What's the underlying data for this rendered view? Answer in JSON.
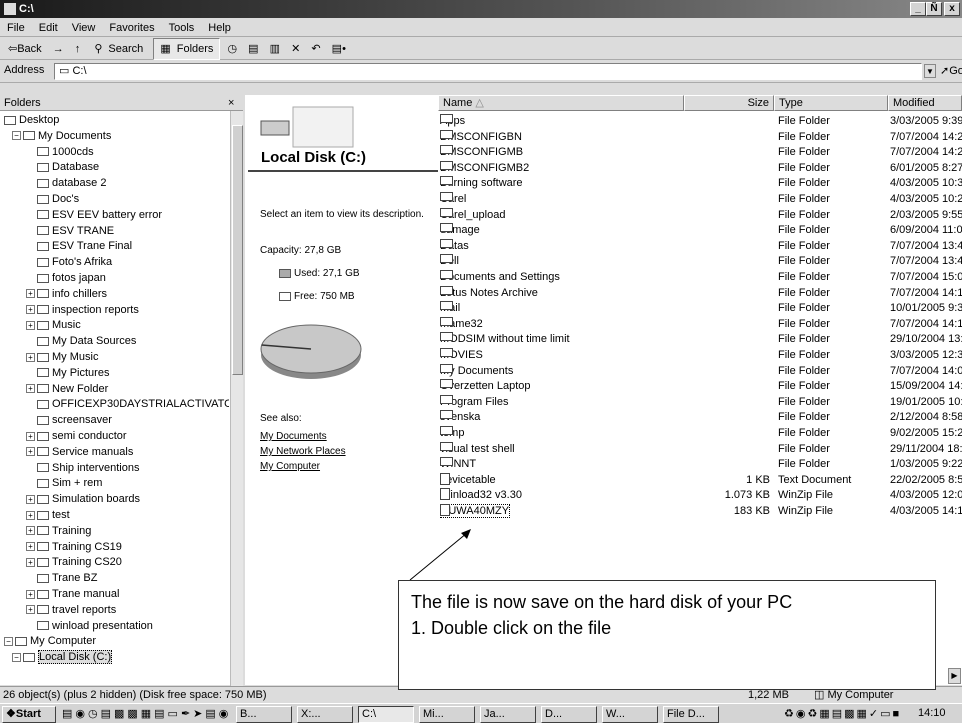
{
  "window": {
    "title": "C:\\",
    "minimize": "_",
    "restore": "Ñ",
    "close": "x"
  },
  "menu": [
    "File",
    "Edit",
    "View",
    "Favorites",
    "Tools",
    "Help"
  ],
  "toolbar": {
    "back": "⇦Back",
    "forward": "→",
    "up": "·",
    "search": "Search",
    "folders": "Folders",
    "views": "▤•"
  },
  "address": {
    "label": "Address",
    "value": "C:\\",
    "go": "Go"
  },
  "folders_pane": {
    "title": "Folders",
    "close": "×",
    "items": [
      {
        "label": "Desktop",
        "pm": "",
        "indent": 0
      },
      {
        "label": "My Documents",
        "pm": "−",
        "indent": 1
      },
      {
        "label": "1000cds",
        "pm": "",
        "indent": 2
      },
      {
        "label": "Database",
        "pm": "",
        "indent": 2
      },
      {
        "label": "database 2",
        "pm": "",
        "indent": 2
      },
      {
        "label": "Doc's",
        "pm": "",
        "indent": 2
      },
      {
        "label": "ESV EEV battery error",
        "pm": "",
        "indent": 2
      },
      {
        "label": "ESV TRANE",
        "pm": "",
        "indent": 2
      },
      {
        "label": "ESV Trane Final",
        "pm": "",
        "indent": 2
      },
      {
        "label": "Foto's Afrika",
        "pm": "",
        "indent": 2
      },
      {
        "label": "fotos japan",
        "pm": "",
        "indent": 2
      },
      {
        "label": "info chillers",
        "pm": "+",
        "indent": 2
      },
      {
        "label": "inspection reports",
        "pm": "+",
        "indent": 2
      },
      {
        "label": "Music",
        "pm": "+",
        "indent": 2
      },
      {
        "label": "My Data Sources",
        "pm": "",
        "indent": 2
      },
      {
        "label": "My Music",
        "pm": "+",
        "indent": 2
      },
      {
        "label": "My Pictures",
        "pm": "",
        "indent": 2
      },
      {
        "label": "New Folder",
        "pm": "+",
        "indent": 2
      },
      {
        "label": "OFFICEXP30DAYSTRIALACTIVATOR",
        "pm": "",
        "indent": 2
      },
      {
        "label": "screensaver",
        "pm": "",
        "indent": 2
      },
      {
        "label": "semi conductor",
        "pm": "+",
        "indent": 2
      },
      {
        "label": "Service manuals",
        "pm": "+",
        "indent": 2
      },
      {
        "label": "Ship interventions",
        "pm": "",
        "indent": 2
      },
      {
        "label": "Sim + rem",
        "pm": "",
        "indent": 2
      },
      {
        "label": "Simulation boards",
        "pm": "+",
        "indent": 2
      },
      {
        "label": "test",
        "pm": "+",
        "indent": 2
      },
      {
        "label": "Training",
        "pm": "+",
        "indent": 2
      },
      {
        "label": "Training CS19",
        "pm": "+",
        "indent": 2
      },
      {
        "label": "Training CS20",
        "pm": "+",
        "indent": 2
      },
      {
        "label": "Trane BZ",
        "pm": "",
        "indent": 2
      },
      {
        "label": "Trane manual",
        "pm": "+",
        "indent": 2
      },
      {
        "label": "travel reports",
        "pm": "+",
        "indent": 2
      },
      {
        "label": "winload presentation",
        "pm": "",
        "indent": 2
      },
      {
        "label": "My Computer",
        "pm": "−",
        "indent": 0
      },
      {
        "label": "Local Disk (C:)",
        "pm": "−",
        "indent": 1
      }
    ]
  },
  "details": {
    "title": "Local Disk (C:)",
    "prompt": "Select an item to view its description.",
    "capacity": "Capacity: 27,8 GB",
    "used": "Used: 27,1 GB",
    "free": "Free: 750 MB",
    "used_fraction": 0.973,
    "see_also": "See also:",
    "links": [
      "My Documents",
      "My Network Places",
      "My Computer"
    ]
  },
  "columns": {
    "name": "Name",
    "size": "Size",
    "type": "Type",
    "modified": "Modified"
  },
  "files": [
    {
      "name": "Apps",
      "size": "",
      "type": "File Folder",
      "modified": "3/03/2005 9:39"
    },
    {
      "name": "BMSCONFIGBN",
      "size": "",
      "type": "File Folder",
      "modified": "7/07/2004 14:2"
    },
    {
      "name": "BMSCONFIGMB",
      "size": "",
      "type": "File Folder",
      "modified": "7/07/2004 14:2"
    },
    {
      "name": "BMSCONFIGMB2",
      "size": "",
      "type": "File Folder",
      "modified": "6/01/2005 8:27"
    },
    {
      "name": "Burning software",
      "size": "",
      "type": "File Folder",
      "modified": "4/03/2005 10:3"
    },
    {
      "name": "Carel",
      "size": "",
      "type": "File Folder",
      "modified": "4/03/2005 10:2"
    },
    {
      "name": "Carel_upload",
      "size": "",
      "type": "File Folder",
      "modified": "2/03/2005 9:55"
    },
    {
      "name": "damage",
      "size": "",
      "type": "File Folder",
      "modified": "6/09/2004 11:0"
    },
    {
      "name": "Datas",
      "size": "",
      "type": "File Folder",
      "modified": "7/07/2004 13:4"
    },
    {
      "name": "Dell",
      "size": "",
      "type": "File Folder",
      "modified": "7/07/2004 13:4"
    },
    {
      "name": "Documents and Settings",
      "size": "",
      "type": "File Folder",
      "modified": "7/07/2004 15:0"
    },
    {
      "name": "Lotus Notes Archive",
      "size": "",
      "type": "File Folder",
      "modified": "7/07/2004 14:1"
    },
    {
      "name": "Mail",
      "size": "",
      "type": "File Folder",
      "modified": "10/01/2005 9:3"
    },
    {
      "name": "mame32",
      "size": "",
      "type": "File Folder",
      "modified": "7/07/2004 14:1"
    },
    {
      "name": "MODSIM without time limit",
      "size": "",
      "type": "File Folder",
      "modified": "29/10/2004 13:"
    },
    {
      "name": "MOVIES",
      "size": "",
      "type": "File Folder",
      "modified": "3/03/2005 12:3"
    },
    {
      "name": "My Documents",
      "size": "",
      "type": "File Folder",
      "modified": "7/07/2004 14:0"
    },
    {
      "name": "Overzetten Laptop",
      "size": "",
      "type": "File Folder",
      "modified": "15/09/2004 14:"
    },
    {
      "name": "Program Files",
      "size": "",
      "type": "File Folder",
      "modified": "19/01/2005 10:"
    },
    {
      "name": "svenska",
      "size": "",
      "type": "File Folder",
      "modified": "2/12/2004 8:58"
    },
    {
      "name": "temp",
      "size": "",
      "type": "File Folder",
      "modified": "9/02/2005 15:2"
    },
    {
      "name": "visual test shell",
      "size": "",
      "type": "File Folder",
      "modified": "29/11/2004 18:"
    },
    {
      "name": "WINNT",
      "size": "",
      "type": "File Folder",
      "modified": "1/03/2005 9:22"
    },
    {
      "name": "devicetable",
      "size": "1 KB",
      "type": "Text Document",
      "modified": "22/02/2005 8:5"
    },
    {
      "name": "Winload32 v3.30",
      "size": "1.073 KB",
      "type": "WinZip File",
      "modified": "4/03/2005 12:0"
    },
    {
      "name": "EUWA40MZY",
      "size": "183 KB",
      "type": "WinZip File",
      "modified": "4/03/2005 14:1"
    }
  ],
  "status": {
    "left": "26 object(s) (plus 2 hidden) (Disk free space: 750 MB)",
    "size": "1,22 MB",
    "zone": "My Computer"
  },
  "taskbar": {
    "start": "Start",
    "tasks": [
      "B...",
      "X:...",
      "C:\\",
      "Mi...",
      "Ja...",
      "D...",
      "W...",
      "File D..."
    ],
    "clock": "14:10"
  },
  "callout": {
    "line1": "The file is now save on the hard disk of your PC",
    "line2": "1.  Double click on the file"
  }
}
